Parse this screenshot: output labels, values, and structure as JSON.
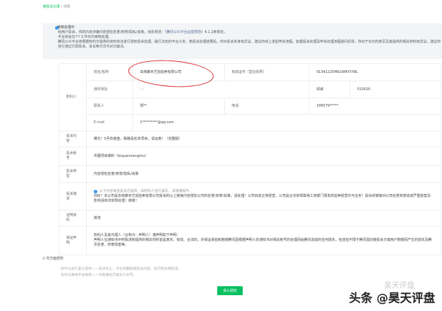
{
  "breadcrumb": {
    "parent": "被投诉记录",
    "sep": "/",
    "current": "详情"
  },
  "notice": {
    "title": "审核处理中",
    "line1": "经用户投诉，你的内容涉嫌内容侵犯名誉/商誉/隐私/肖像，违反规范：",
    "link": "《腾讯公众平台运营规范》",
    "line1b": "4.1.2条规定。",
    "line2": "平台将会在7个工作日内审核处理。",
    "line3": "腾讯公众平台将根据权利方提供的资料依法进行侵权投诉处理，履行法定的平台义务。若投诉处理结果后，你对投诉本身有异议，建议你线上发起申诉流程。如遇投诉处理及申诉处理流程疑问反馈，你对于对方的意见及其提供的相关材料有异议，建议你自行通过行政投诉、诉讼等方式与对方解决。"
  },
  "rights_holder": {
    "label": "权利人",
    "name_label": "姓名/名称",
    "name": "阜南聚禾艺拍拍卖有限公司",
    "id_label": "有效证件（营业执照）",
    "id": "91341225MA2WRYXY8L",
    "addr_label": "通讯地址",
    "addr": "- -",
    "zip_label": "邮编",
    "zip": "510020",
    "contact_label": "联系人",
    "contact": "郭**",
    "phone_label": "电话",
    "phone": "186579*****",
    "email_label": "E-mail",
    "email": "1*********@qq.com"
  },
  "rows": {
    "content_label": "投诉内容",
    "content": "曝光！5月份装盘，跑路黑名单项目，请远离！（完整版）",
    "account_label": "投诉帐号",
    "account": "币圈项目爆料（biquanxiangmu）",
    "type_label": "投诉类型",
    "type": "内容侵犯名誉/商誉/隐私/肖像",
    "desc_label": "投诉描述",
    "desc_tip": "以下内容来自投诉方提供，由权利人自行填写，请谨慎操作。",
    "desc": "你好！本公司是阜南聚禾艺拍拍卖有限公司投诉的以上链接内容侵犯公司的名誉/商誉/肖像，请处理！公司目前正常经营，公司是合法依规取得工商部门颁发的拍卖经营许可业务！投诉的链接对公司名誉商誉造成严重损害及影响请依法依规处理！谢谢！",
    "proof_label": "证明资料",
    "proof": "其他",
    "stmt_label": "保证声明",
    "stmt1": "权利人及其代理人（合称为：声明人）谨声明如下声明：",
    "stmt2": "声明人在通知书中所陈述和提供的相关材料皆是真实、有效、合法的，并保证承担和赔偿腾讯因根据声明人的通知书对相关帐号的处理而给腾讯造成的任何损失，包括但不限于腾讯因向被投诉方或用户赔偿而产生的损失及腾讯名誉、商誉损害等。"
  },
  "section": {
    "title": "// 仅方面侵权",
    "hint1": "你可以自行承认侵权——投诉终止，平台将删除被投诉内容，处罚将会被取消；",
    "hint2": "也可以等待平台审核——可能被处罚或永久封号。",
    "button": "承认侵权"
  },
  "watermark": {
    "top": "昊天评盘",
    "main": "头条 @昊天评盘"
  }
}
